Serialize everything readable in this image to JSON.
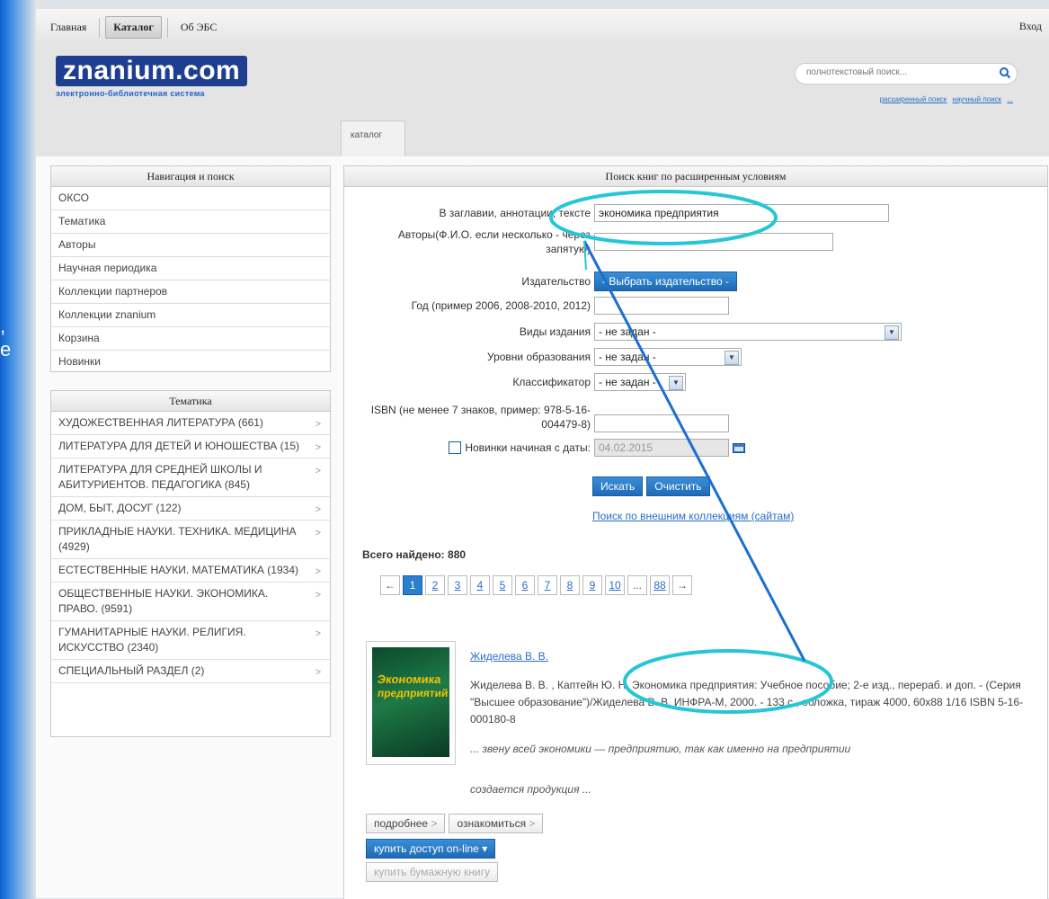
{
  "stripe": {
    "glyph1": ",",
    "glyph2": "е"
  },
  "topnav": {
    "items": [
      "Главная",
      "Каталог",
      "Об ЭБС"
    ],
    "login": "Вход"
  },
  "logo": {
    "main": "znanium.com",
    "sub": "электронно-библиотечная система"
  },
  "search": {
    "placeholder": "полнотекстовый поиск...",
    "links": [
      "расширенный поиск",
      "научный поиск",
      "..."
    ]
  },
  "tab": {
    "label": "каталог"
  },
  "nav_panel": {
    "title": "Навигация и поиск",
    "items": [
      "ОКСО",
      "Тематика",
      "Авторы",
      "Научная периодика",
      "Коллекции партнеров",
      "Коллекции znanium",
      "Корзина",
      "Новинки"
    ]
  },
  "theme_panel": {
    "title": "Тематика",
    "items": [
      "ХУДОЖЕСТВЕННАЯ ЛИТЕРАТУРА (661)",
      "ЛИТЕРАТУРА ДЛЯ ДЕТЕЙ И ЮНОШЕСТВА (15)",
      "ЛИТЕРАТУРА ДЛЯ СРЕДНЕЙ ШКОЛЫ И АБИТУРИЕНТОВ. ПЕДАГОГИКА (845)",
      "ДОМ, БЫТ, ДОСУГ (122)",
      "ПРИКЛАДНЫЕ НАУКИ. ТЕХНИКА. МЕДИЦИНА (4929)",
      "ЕСТЕСТВЕННЫЕ НАУКИ. МАТЕМАТИКА (1934)",
      "ОБЩЕСТВЕННЫЕ НАУКИ. ЭКОНОМИКА. ПРАВО. (9591)",
      "ГУМАНИТАРНЫЕ НАУКИ. РЕЛИГИЯ. ИСКУССТВО (2340)",
      "СПЕЦИАЛЬНЫЙ РАЗДЕЛ (2)"
    ],
    "arrow": ">"
  },
  "form": {
    "title": "Поиск книг по расширенным условиям",
    "title_label": "В заглавии, аннотации, тексте",
    "title_value": "экономика предприятия",
    "authors_label": "Авторы(Ф.И.О. если несколько - через запятую)",
    "authors_value": "",
    "publisher_label": "Издательство",
    "publisher_button": "- Выбрать издательство -",
    "year_label": "Год (пример 2006, 2008-2010, 2012)",
    "year_value": "",
    "types_label": "Виды издания",
    "types_value": "- не задан -",
    "levels_label": "Уровни образования",
    "levels_value": "- не задан -",
    "classifier_label": "Классификатор",
    "classifier_value": "- не задан -",
    "isbn_label": "ISBN (не менее 7 знаков, пример: 978-5-16-004479-8)",
    "isbn_value": "",
    "new_since_label": "Новинки начиная с даты:",
    "new_since_value": "04.02.2015",
    "search_button": "Искать",
    "clear_button": "Очистить",
    "external_link": "Поиск по внешним коллекциям (сайтам)"
  },
  "results": {
    "total_label": "Всего найдено: 880",
    "pages": [
      "←",
      "1",
      "2",
      "3",
      "4",
      "5",
      "6",
      "7",
      "8",
      "9",
      "10",
      "...",
      "88",
      "→"
    ],
    "current_page": "1"
  },
  "book": {
    "cover_text1": "Экономика",
    "cover_text2": "предприятий",
    "author_link": "Жиделева В. В.",
    "description": "Жиделева В. В. , Каптейн Ю. Н. Экономика предприятия: Учебное пособие; 2-е изд., перераб. и доп. - (Серия \"Высшее образование\")/Жиделева В. В. ИНФРА-М, 2000. - 133 с., обложка, тираж 4000, 60x88 1/16 ISBN 5-16-000180-8",
    "snippet1": "... звену всей экономики — предприятию, так как именно на предприятии",
    "snippet2": "создается продукция ...",
    "more_button": "подробнее",
    "preview_button": "ознакомиться",
    "buy_online_button": "купить доступ on-line",
    "buy_paper_button": "купить бумажную книгу"
  },
  "colors": {
    "accent": "#2a7fd0",
    "highlight": "#27c6d6",
    "arrow": "#1a6fd0"
  }
}
